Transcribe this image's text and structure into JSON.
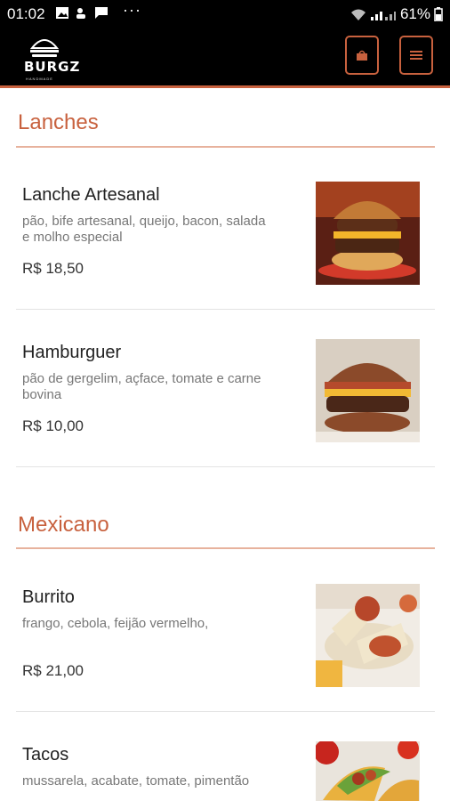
{
  "statusbar": {
    "time": "01:02",
    "overflow": "···",
    "battery": "61%"
  },
  "header": {
    "logo_text": "BURGZ",
    "logo_sub": "HANDMADE",
    "cart_icon": "shopping-bag-icon",
    "menu_icon": "hamburger-menu-icon"
  },
  "colors": {
    "accent": "#c8613e",
    "header_bg": "#000000"
  },
  "sections": [
    {
      "title": "Lanches",
      "items": [
        {
          "name": "Lanche Artesanal",
          "desc": "pão, bife artesanal, queijo, bacon, salada e molho especial",
          "price": "R$ 18,50"
        },
        {
          "name": "Hamburguer",
          "desc": "pão de gergelim, açface, tomate e carne bovina",
          "price": "R$ 10,00"
        }
      ]
    },
    {
      "title": "Mexicano",
      "items": [
        {
          "name": "Burrito",
          "desc": "frango, cebola, feijão vermelho,",
          "price": "R$ 21,00"
        },
        {
          "name": "Tacos",
          "desc": "mussarela, acabate, tomate, pimentão",
          "price": ""
        }
      ]
    }
  ]
}
